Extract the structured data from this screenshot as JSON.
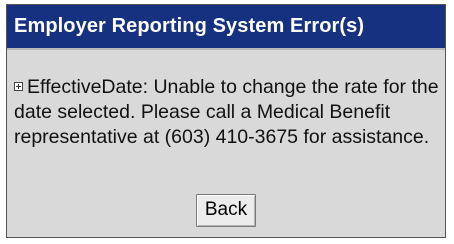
{
  "dialog": {
    "title": "Employer Reporting System Error(s)",
    "message_label": "EffectiveDate:",
    "message_text": "Unable to change the rate for the date selected. Please call a Medical Benefit representative at (603) 410-3675 for assistance.",
    "expand_icon": "plus-box-icon",
    "back_label": "Back"
  },
  "colors": {
    "title_bar": "#16317f",
    "title_text": "#ffffff",
    "panel_background": "#d9d9d9"
  }
}
